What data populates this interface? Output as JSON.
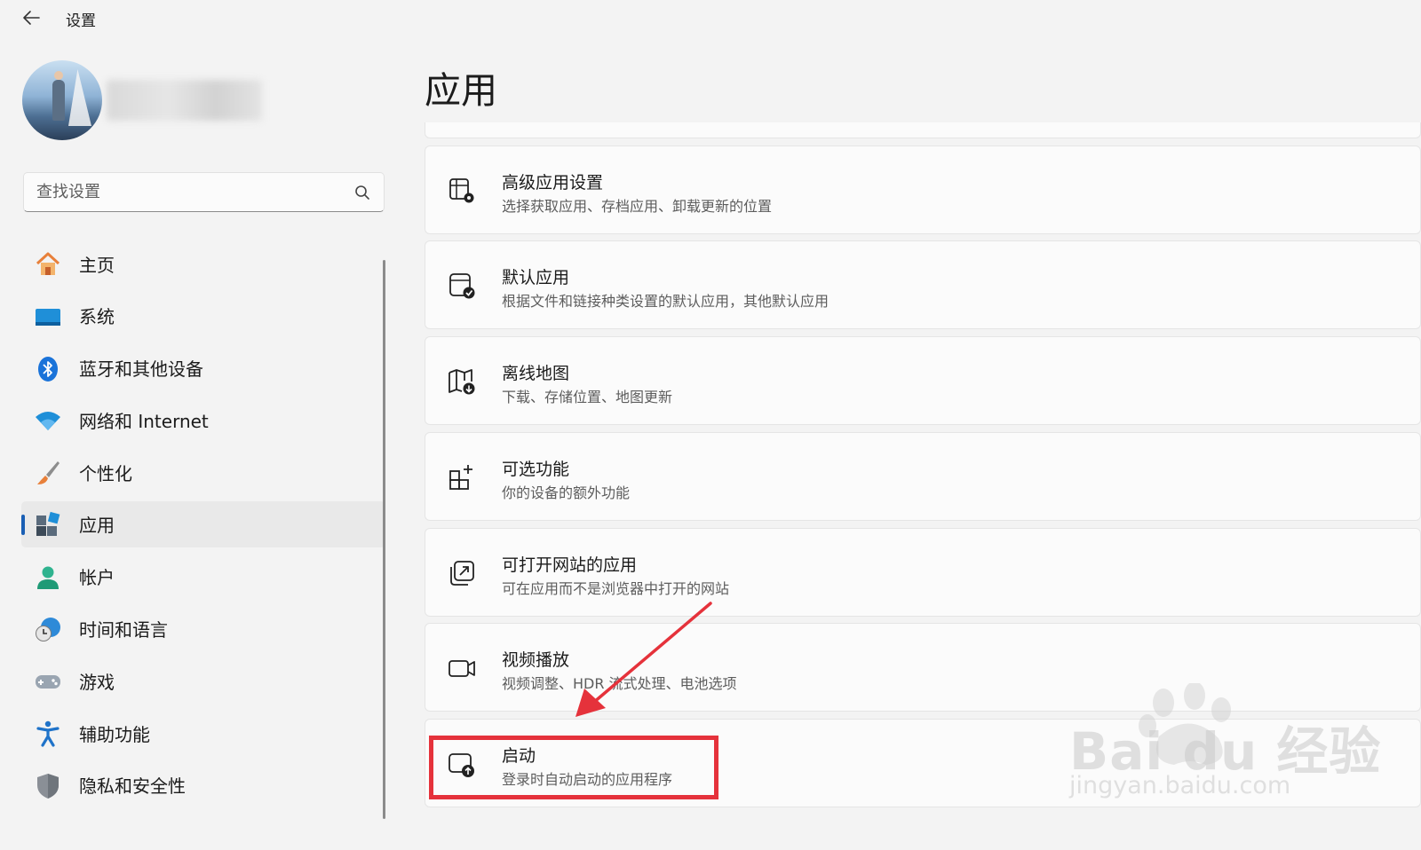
{
  "titlebar": {
    "title": "设置"
  },
  "search": {
    "placeholder": "查找设置"
  },
  "nav": {
    "items": [
      {
        "label": "主页",
        "icon": "home-icon"
      },
      {
        "label": "系统",
        "icon": "system-icon"
      },
      {
        "label": "蓝牙和其他设备",
        "icon": "bluetooth-icon"
      },
      {
        "label": "网络和 Internet",
        "icon": "wifi-icon"
      },
      {
        "label": "个性化",
        "icon": "brush-icon"
      },
      {
        "label": "应用",
        "icon": "apps-icon",
        "selected": true
      },
      {
        "label": "帐户",
        "icon": "account-icon"
      },
      {
        "label": "时间和语言",
        "icon": "clock-globe-icon"
      },
      {
        "label": "游戏",
        "icon": "gamepad-icon"
      },
      {
        "label": "辅助功能",
        "icon": "accessibility-icon"
      },
      {
        "label": "隐私和安全性",
        "icon": "shield-icon"
      }
    ]
  },
  "main": {
    "title": "应用",
    "cards": [
      {
        "title": "高级应用设置",
        "subtitle": "选择获取应用、存档应用、卸载更新的位置",
        "icon": "app-settings-icon"
      },
      {
        "title": "默认应用",
        "subtitle": "根据文件和链接种类设置的默认应用，其他默认应用",
        "icon": "default-apps-icon"
      },
      {
        "title": "离线地图",
        "subtitle": "下载、存储位置、地图更新",
        "icon": "offline-map-icon"
      },
      {
        "title": "可选功能",
        "subtitle": "你的设备的额外功能",
        "icon": "optional-features-icon"
      },
      {
        "title": "可打开网站的应用",
        "subtitle": "可在应用而不是浏览器中打开的网站",
        "icon": "open-website-icon"
      },
      {
        "title": "视频播放",
        "subtitle": "视频调整、HDR 流式处理、电池选项",
        "icon": "video-camera-icon"
      },
      {
        "title": "启动",
        "subtitle": "登录时自动启动的应用程序",
        "icon": "startup-icon"
      }
    ]
  },
  "annotation": {
    "color": "#e5323b"
  },
  "watermark": {
    "text": "Bai du 经验",
    "url": "jingyan.baidu.com"
  }
}
